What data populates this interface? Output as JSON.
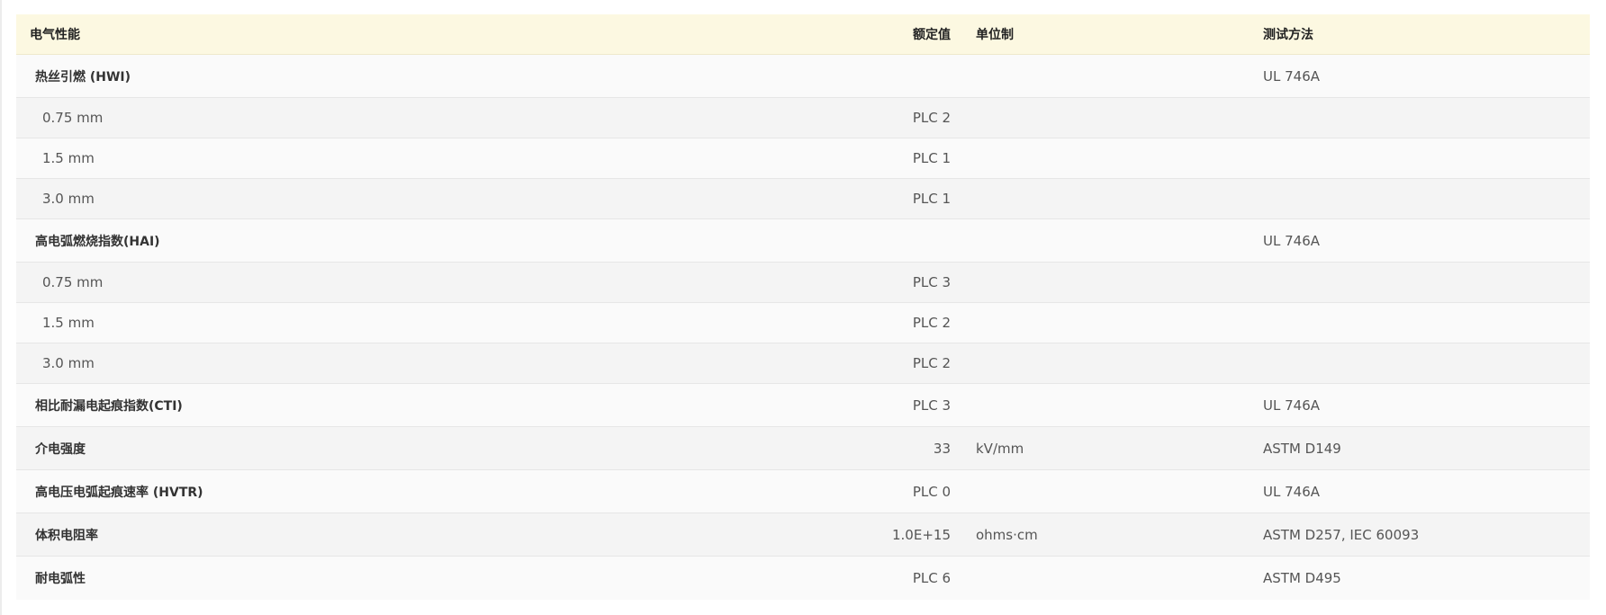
{
  "header": {
    "property": "电气性能",
    "value": "额定值",
    "unit": "单位制",
    "method": "测试方法"
  },
  "hwi": {
    "name": "热丝引燃 (HWI)",
    "method": "UL 746A",
    "rows": [
      {
        "thickness": "0.75 mm",
        "value": "PLC 2"
      },
      {
        "thickness": "1.5 mm",
        "value": "PLC 1"
      },
      {
        "thickness": "3.0 mm",
        "value": "PLC 1"
      }
    ]
  },
  "hai": {
    "name": "高电弧燃烧指数(HAI)",
    "method": "UL 746A",
    "rows": [
      {
        "thickness": "0.75 mm",
        "value": "PLC 3"
      },
      {
        "thickness": "1.5 mm",
        "value": "PLC 2"
      },
      {
        "thickness": "3.0 mm",
        "value": "PLC 2"
      }
    ]
  },
  "cti": {
    "name": "相比耐漏电起痕指数(CTI)",
    "value": "PLC 3",
    "unit": "",
    "method": "UL 746A"
  },
  "dielectric": {
    "name": "介电强度",
    "value": "33",
    "unit": "kV/mm",
    "method": "ASTM D149"
  },
  "hvtr": {
    "name": "高电压电弧起痕速率 (HVTR)",
    "value": "PLC 0",
    "unit": "",
    "method": "UL 746A"
  },
  "resistivity": {
    "name": "体积电阻率",
    "value": "1.0E+15",
    "unit": "ohms·cm",
    "method": "ASTM D257, IEC 60093"
  },
  "arc": {
    "name": "耐电弧性",
    "value": "PLC 6",
    "unit": "",
    "method": "ASTM D495"
  }
}
